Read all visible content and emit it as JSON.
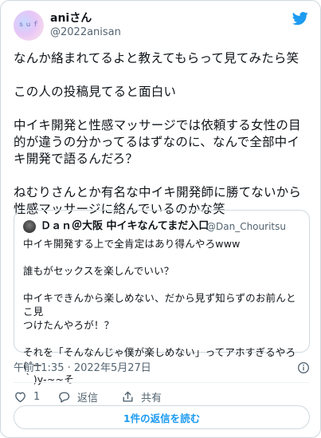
{
  "author": {
    "avatar_text": "ｓｕｆ",
    "name": "aniさん",
    "handle": "@2022anisan"
  },
  "tweet": {
    "paragraphs": [
      "なんか絡まれてるよと教えてもらって見てみたら笑",
      "この人の投稿見てると面白い",
      "中イキ開発と性感マッサージでは依頼する女性の目\n的が違うの分かってるはずなのに、なんで全部中イ\nキ開発で語るんだろ？",
      "ねむりさんとか有名な中イキ開発師に勝てないから\n性感マッサージに絡んでいるのかな笑"
    ]
  },
  "quoted": {
    "name": "Ｄａｎ＠大阪 中イキなんてまだ入口",
    "handle": "@Dan_Chouritsu",
    "paragraphs": [
      "中イキ開発する上で全肯定はあり得んやろwww",
      "誰もがセックスを楽しんでいい？",
      "中イキできんから楽しめない、だから見ず知らずのお前んとこ見\nつけたんやろが！？",
      "それを「そんなんじゃ僕が楽しめない」ってアホすぎるやろ(´ー\n｀)y-~~そ"
    ]
  },
  "meta": {
    "timestamp": "午前11:35 · 2022年5月27日"
  },
  "actions": {
    "like_count": "1",
    "reply_label": "返信",
    "share_label": "共有"
  },
  "read_replies_label": "1件の返信を読む",
  "colors": {
    "accent": "#1d9bf0",
    "secondary_text": "#536471",
    "border": "#cfd9de"
  },
  "icons": [
    "twitter-bird-icon",
    "info-icon",
    "heart-icon",
    "reply-bubble-icon",
    "share-upload-icon"
  ]
}
